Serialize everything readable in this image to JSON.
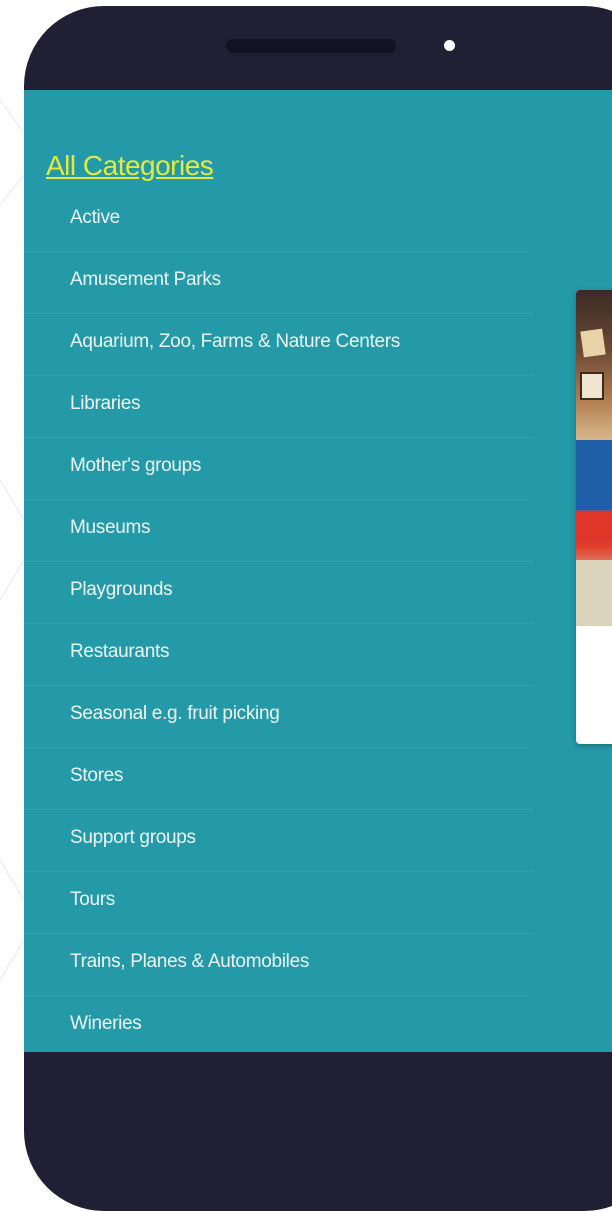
{
  "header": {
    "all_categories_label": "All Categories"
  },
  "categories": [
    {
      "label": "Active"
    },
    {
      "label": "Amusement Parks"
    },
    {
      "label": "Aquarium, Zoo, Farms & Nature Centers"
    },
    {
      "label": "Libraries"
    },
    {
      "label": "Mother's groups"
    },
    {
      "label": "Museums"
    },
    {
      "label": "Playgrounds"
    },
    {
      "label": "Restaurants"
    },
    {
      "label": "Seasonal e.g. fruit picking"
    },
    {
      "label": "Stores"
    },
    {
      "label": "Support groups"
    },
    {
      "label": "Tours"
    },
    {
      "label": "Trains, Planes & Automobiles"
    },
    {
      "label": "Wineries"
    }
  ],
  "colors": {
    "screen_background": "#2499a8",
    "phone_frame": "#201f33",
    "link_accent": "#e2ea3f",
    "item_text": "#eef8fa"
  },
  "icons": {
    "camera": "front-camera-dot",
    "speaker": "earpiece-speaker"
  }
}
